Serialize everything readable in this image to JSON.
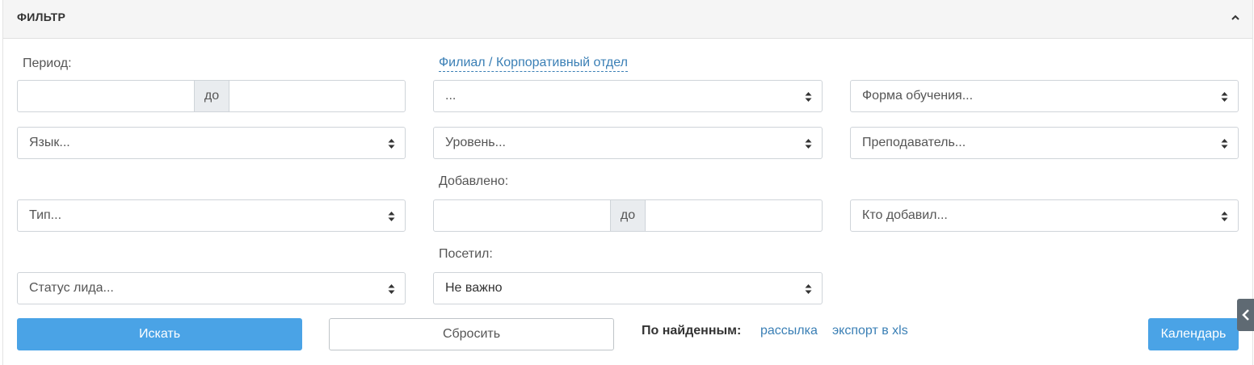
{
  "panel": {
    "title": "ФИЛЬТР"
  },
  "fields": {
    "period_label": "Период:",
    "period_separator": "до",
    "branch_label": "Филиал / Корпоративный отдел",
    "branch_value": "...",
    "study_form": "Форма обучения...",
    "language": "Язык...",
    "level": "Уровень...",
    "teacher": "Преподаватель...",
    "added_label": "Добавлено:",
    "added_separator": "до",
    "type": "Тип...",
    "who_added": "Кто добавил...",
    "visited_label": "Посетил:",
    "lead_status": "Статус лида...",
    "visited_value": "Не важно"
  },
  "actions": {
    "search": "Искать",
    "reset": "Сбросить",
    "found_label": "По найденным:",
    "mailing": "рассылка",
    "export_xls": "экспорт в xls",
    "calendar": "Календарь"
  },
  "colors": {
    "primary": "#4aa3e6",
    "link": "#3a7fb5",
    "header_bg": "#f5f5f5"
  },
  "icons": {
    "collapse": "chevron-up-icon",
    "select_arrows": "sort-arrows-icon",
    "side_tab": "chevron-left-icon"
  }
}
